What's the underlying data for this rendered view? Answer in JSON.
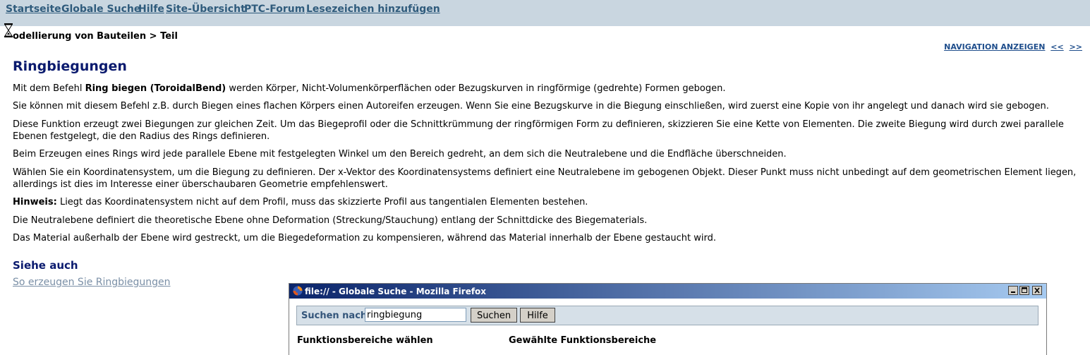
{
  "topnav": {
    "items": [
      {
        "label": "Startseite"
      },
      {
        "label": "Globale Suche"
      },
      {
        "label": "Hilfe"
      },
      {
        "label": "Site-Übersicht"
      },
      {
        "label": "PTC-Forum"
      },
      {
        "label": "Lesezeichen hinzufügen"
      }
    ]
  },
  "breadcrumb": "odellierung von Bauteilen > Teil",
  "nav": {
    "show_navigation": "NAVIGATION ANZEIGEN",
    "prev": "<<",
    "next": ">>"
  },
  "content": {
    "title": "Ringbiegungen",
    "p1_before": "Mit dem Befehl ",
    "p1_bold": "Ring biegen (ToroidalBend)",
    "p1_after": " werden Körper, Nicht-Volumenkörperflächen oder Bezugskurven in ringförmige (gedrehte) Formen gebogen.",
    "p2": "Sie können mit diesem Befehl z.B. durch Biegen eines flachen Körpers einen Autoreifen erzeugen. Wenn Sie eine Bezugskurve in die Biegung einschließen, wird zuerst eine Kopie von ihr angelegt und danach wird sie gebogen.",
    "p3": "Diese Funktion erzeugt zwei Biegungen zur gleichen Zeit. Um das Biegeprofil oder die Schnittkrümmung der ringförmigen Form zu definieren, skizzieren Sie eine Kette von Elementen. Die zweite Biegung wird durch zwei parallele Ebenen festgelegt, die den Radius des Rings definieren.",
    "p4": "Beim Erzeugen eines Rings wird jede parallele Ebene mit festgelegten Winkel um den Bereich gedreht, an dem sich die Neutralebene und die Endfläche überschneiden.",
    "p5": "Wählen Sie ein Koordinatensystem, um die Biegung zu definieren. Der x-Vektor des Koordinatensystems definiert eine Neutralebene im gebogenen Objekt. Dieser Punkt muss nicht unbedingt auf dem geometrischen Element liegen, allerdings ist dies im Interesse einer überschaubaren Geometrie empfehlenswert.",
    "note_label": "Hinweis:",
    "note_text": " Liegt das Koordinatensystem nicht auf dem Profil, muss das skizzierte Profil aus tangentialen Elementen bestehen.",
    "p7": "Die Neutralebene definiert die theoretische Ebene ohne Deformation (Streckung/Stauchung) entlang der Schnittdicke des Biegematerials.",
    "p8": "Das Material außerhalb der Ebene wird gestreckt, um die Biegedeformation zu kompensieren, während das Material innerhalb der Ebene gestaucht wird.",
    "see_also": "Siehe auch",
    "see_also_link": "So erzeugen Sie Ringbiegungen"
  },
  "popup": {
    "window_title": "file:// - Globale Suche - Mozilla Firefox",
    "search_label": "Suchen nach:",
    "search_value": "ringbiegung",
    "search_button": "Suchen",
    "help_button": "Hilfe",
    "left_heading": "Funktionsbereiche wählen",
    "right_heading": "Gewählte Funktionsbereiche"
  },
  "colors": {
    "topbar_bg": "#c9d6e0",
    "nav_link": "#2f5b7c",
    "heading": "#0a1a6e",
    "titlebar_start": "#0a246a",
    "titlebar_end": "#a6caf0"
  }
}
